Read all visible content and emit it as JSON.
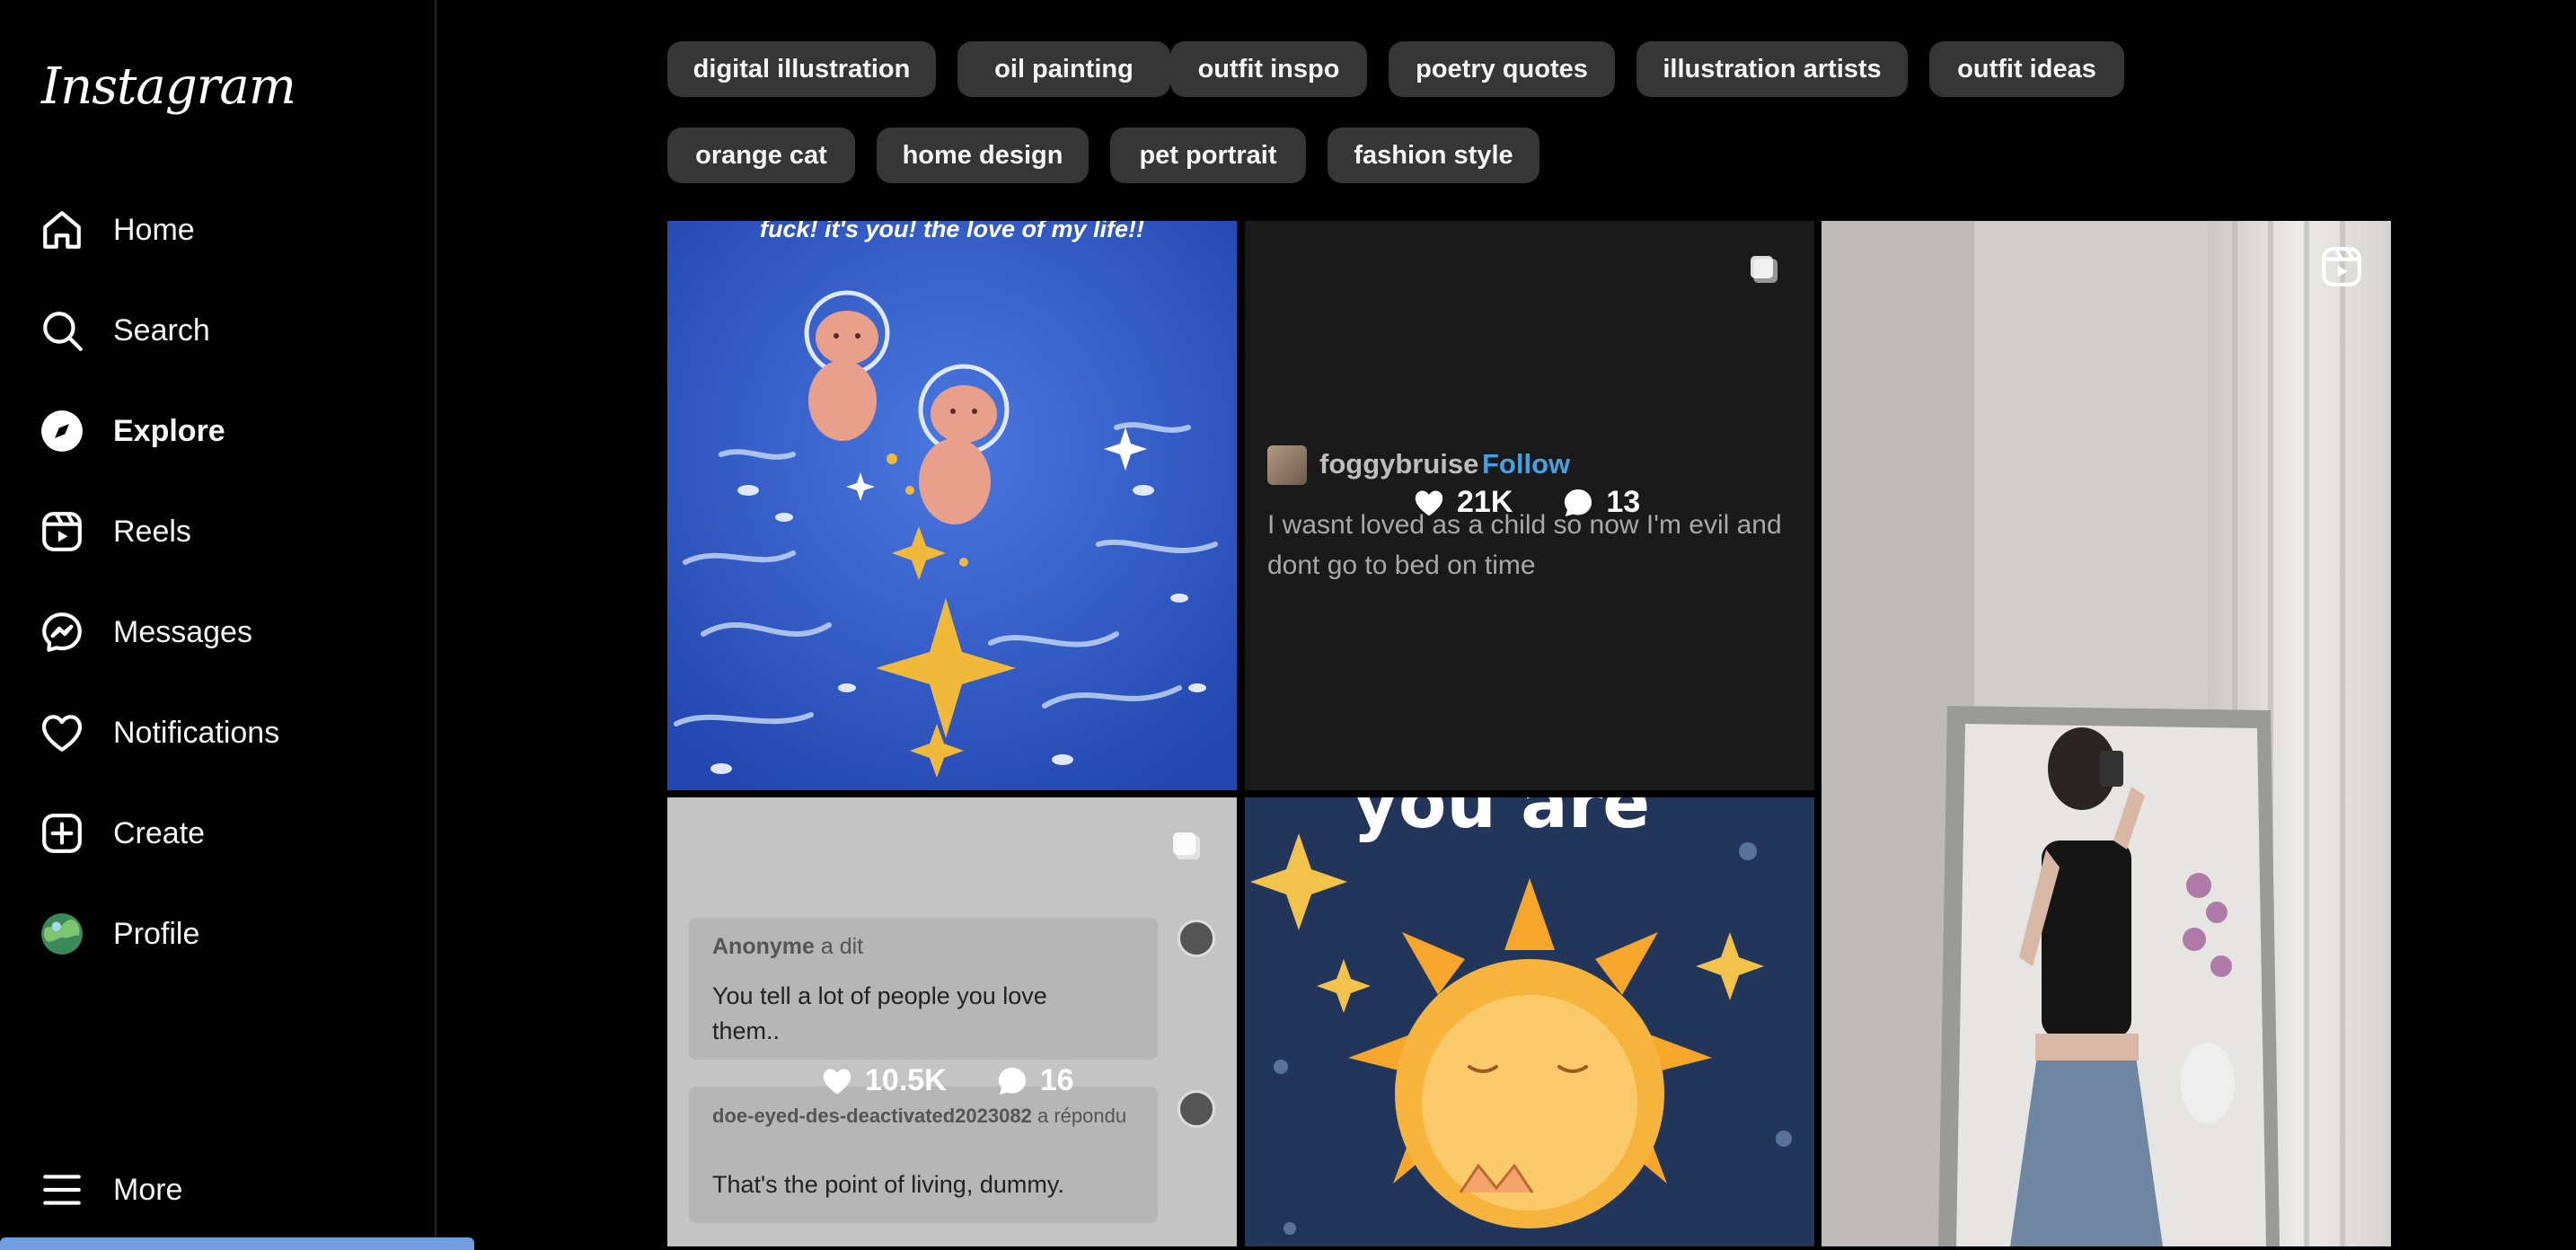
{
  "sidebar": {
    "logo": "Instagram",
    "items": [
      {
        "label": "Home",
        "icon": "home-icon"
      },
      {
        "label": "Search",
        "icon": "search-icon"
      },
      {
        "label": "Explore",
        "icon": "explore-icon",
        "active": true
      },
      {
        "label": "Reels",
        "icon": "reels-icon"
      },
      {
        "label": "Messages",
        "icon": "messages-icon"
      },
      {
        "label": "Notifications",
        "icon": "heart-icon"
      },
      {
        "label": "Create",
        "icon": "create-icon"
      },
      {
        "label": "Profile",
        "icon": "profile-avatar"
      }
    ],
    "more": "More"
  },
  "chips": [
    "digital illustration",
    "oil painting",
    "outfit inspo",
    "poetry quotes",
    "illustration artists",
    "outfit ideas",
    "orange cat",
    "home design",
    "pet portrait",
    "fashion style"
  ],
  "posts": {
    "p1": {
      "caption": "fuck! it's you! the love of my life!!"
    },
    "p2": {
      "username": "foggybruise",
      "follow": "Follow",
      "text": "I wasnt loved as a child so now I'm evil and dont go to bed on time",
      "likes": "21K",
      "comments": "13"
    },
    "p3": {
      "anon_name": "Anonyme",
      "anon_verb": "a dit",
      "anon_text": "You tell a lot of people you love them..",
      "reply_user": "doe-eyed-des-deactivated2023082",
      "reply_verb": "a répondu",
      "reply_text": "That's the point of living, dummy.",
      "likes": "10.5K",
      "comments": "16"
    },
    "p4": {
      "caption": "you are"
    }
  },
  "colors": {
    "accent": "#4a9fe0",
    "chip_bg": "#363636",
    "background": "#000000"
  }
}
